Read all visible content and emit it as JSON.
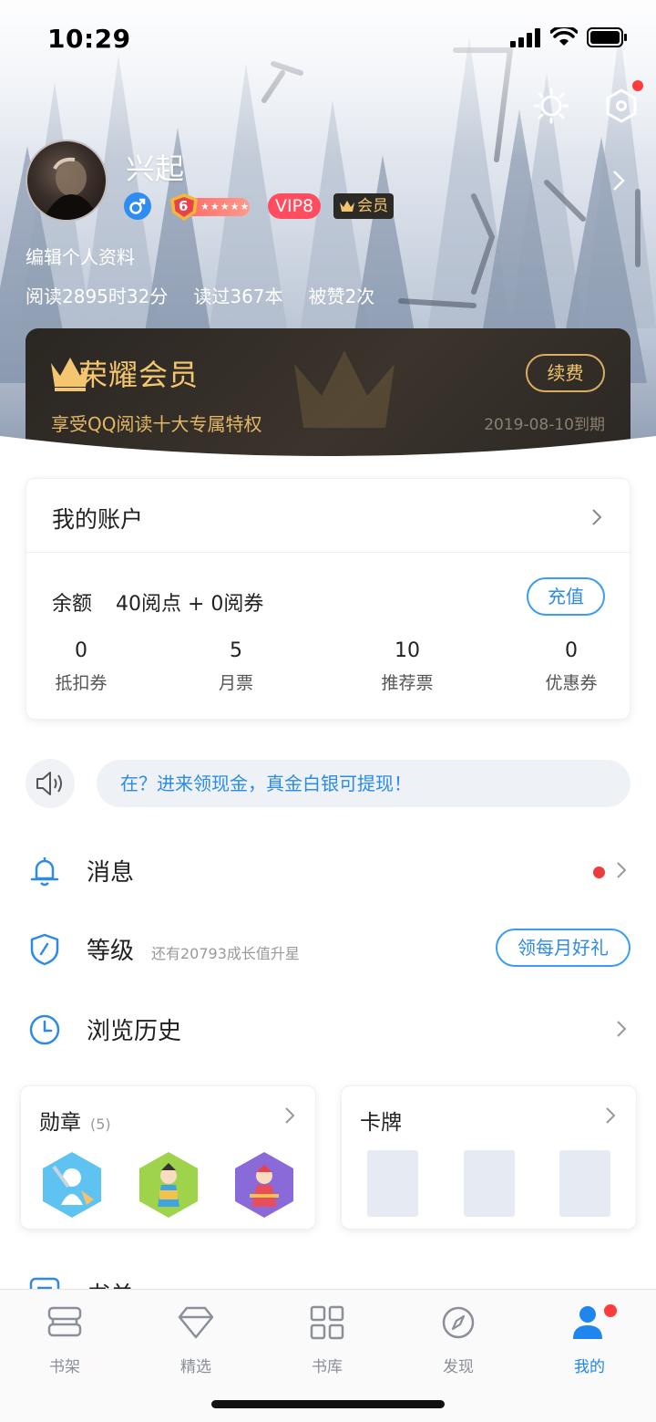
{
  "status_bar": {
    "time": "10:29"
  },
  "profile": {
    "username": "兴起",
    "level": "6",
    "level_stars": "★★★★★",
    "vip": "VIP8",
    "member": "会员",
    "edit_label": "编辑个人资料",
    "stats": [
      "阅读2895时32分",
      "读过367本",
      "被赞2次"
    ]
  },
  "vip_card": {
    "title": "荣耀会员",
    "renew": "续费",
    "desc": "享受QQ阅读十大专属特权",
    "expire": "2019-08-10到期"
  },
  "account": {
    "title": "我的账户",
    "balance_label": "余额",
    "balance_value": "40阅点 + 0阅券",
    "recharge": "充值",
    "items": [
      {
        "value": "0",
        "label": "抵扣券"
      },
      {
        "value": "5",
        "label": "月票"
      },
      {
        "value": "10",
        "label": "推荐票"
      },
      {
        "value": "0",
        "label": "优惠券"
      }
    ]
  },
  "notice": {
    "text": "在？进来领现金，真金白银可提现！"
  },
  "menu": {
    "messages": "消息",
    "level": "等级",
    "level_hint": "还有20793成长值升星",
    "level_button": "领每月好礼",
    "history": "浏览历史",
    "booklist": "书单"
  },
  "medals": {
    "title": "勋章",
    "count": "(5)"
  },
  "cards": {
    "title": "卡牌"
  },
  "tabs": [
    "书架",
    "精选",
    "书库",
    "发现",
    "我的"
  ],
  "colors": {
    "accent": "#1f86f0",
    "gold": "#f3c66f",
    "alert": "#ee3b3b"
  }
}
